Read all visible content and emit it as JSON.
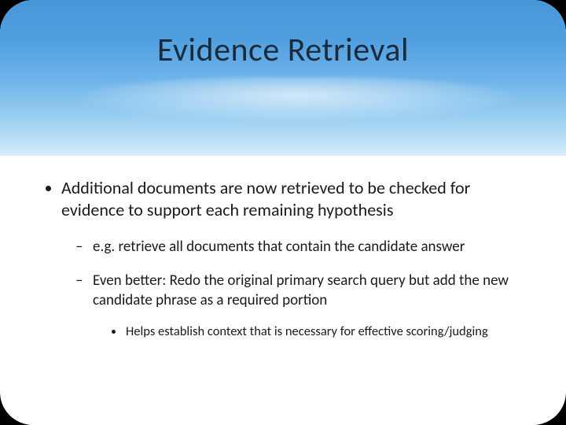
{
  "title": "Evidence Retrieval",
  "bullets": {
    "main": "Additional documents are now retrieved to be checked for evidence to support each remaining hypothesis",
    "sub1": "e.g. retrieve all documents that contain the candidate answer",
    "sub2": "Even better: Redo the original primary search query but add the new candidate phrase as a required portion",
    "sub2a": "Helps establish context that is necessary for effective scoring/judging"
  }
}
